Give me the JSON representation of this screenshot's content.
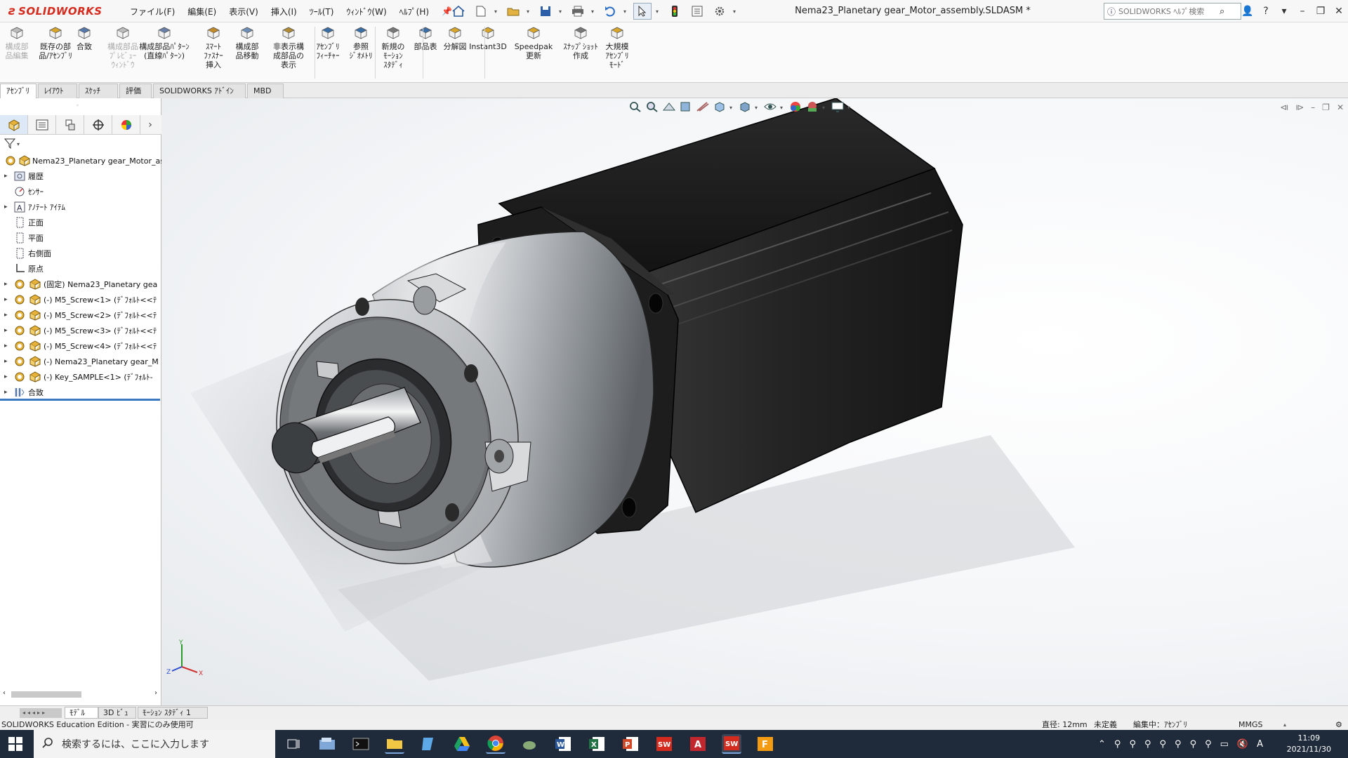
{
  "app": {
    "brand": "SOLIDWORKS",
    "title": "Nema23_Planetary gear_Motor_assembly.SLDASM *",
    "menus": [
      "ファイル(F)",
      "編集(E)",
      "表示(V)",
      "挿入(I)",
      "ﾂｰﾙ(T)",
      "ｳｨﾝﾄﾞｳ(W)",
      "ﾍﾙﾌﾟ(H)"
    ],
    "help_search_placeholder": "SOLIDWORKS ﾍﾙﾌﾟ検索"
  },
  "ribbon": {
    "items": [
      {
        "label": "構成部\n品編集",
        "enabled": false
      },
      {
        "label": "既存の部\n品/ｱｾﾝﾌﾞﾘ",
        "enabled": true
      },
      {
        "label": "合致",
        "enabled": true
      },
      {
        "label": "構成部品\nﾌﾟﾚﾋﾞｭｰ\nｳｨﾝﾄﾞｳ",
        "enabled": false
      },
      {
        "label": "構成部品ﾊﾟﾀｰﾝ\n(直線ﾊﾟﾀｰﾝ)",
        "enabled": true
      },
      {
        "label": "ｽﾏｰﾄ\nﾌｧｽﾅｰ\n挿入",
        "enabled": true
      },
      {
        "label": "構成部\n品移動",
        "enabled": true
      },
      {
        "label": "非表示構\n成部品の\n表示",
        "enabled": true
      },
      {
        "label": "ｱｾﾝﾌﾞﾘ\nﾌｨｰﾁｬｰ",
        "enabled": true
      },
      {
        "label": "参照\nｼﾞｵﾒﾄﾘ",
        "enabled": true
      },
      {
        "label": "新規の\nﾓｰｼｮﾝ\nｽﾀﾃﾞｨ",
        "enabled": true
      },
      {
        "label": "部品表",
        "enabled": true
      },
      {
        "label": "分解図",
        "enabled": true
      },
      {
        "label": "Instant3D",
        "enabled": true
      },
      {
        "label": "Speedpak\n更新",
        "enabled": true
      },
      {
        "label": "ｽﾅｯﾌﾟｼｮｯﾄ\n作成",
        "enabled": true
      },
      {
        "label": "大規模\nｱｾﾝﾌﾞﾘ\nﾓｰﾄﾞ",
        "enabled": true
      }
    ]
  },
  "cm_tabs": [
    "ｱｾﾝﾌﾞﾘ",
    "ﾚｲｱｳﾄ",
    "ｽｹｯﾁ",
    "評価",
    "SOLIDWORKS ｱﾄﾞｲﾝ",
    "MBD"
  ],
  "tree": [
    {
      "label": "Nema23_Planetary gear_Motor_as",
      "icon": "assembly-icon",
      "expand": ""
    },
    {
      "label": "履歴",
      "icon": "history-icon",
      "expand": "▸"
    },
    {
      "label": "ｾﾝｻｰ",
      "icon": "sensor-icon",
      "expand": ""
    },
    {
      "label": "ｱﾉﾃｰﾄ ｱｲﾃﾑ",
      "icon": "annotation-icon",
      "expand": "▸"
    },
    {
      "label": "正面",
      "icon": "plane-icon",
      "expand": ""
    },
    {
      "label": "平面",
      "icon": "plane-icon",
      "expand": ""
    },
    {
      "label": "右側面",
      "icon": "plane-icon",
      "expand": ""
    },
    {
      "label": "原点",
      "icon": "origin-icon",
      "expand": ""
    },
    {
      "label": "(固定) Nema23_Planetary gea",
      "icon": "part-icon",
      "expand": "▸"
    },
    {
      "label": "(-) M5_Screw<1> (ﾃﾞﾌｫﾙﾄ<<ﾃ",
      "icon": "part-icon",
      "expand": "▸"
    },
    {
      "label": "(-) M5_Screw<2> (ﾃﾞﾌｫﾙﾄ<<ﾃ",
      "icon": "part-icon",
      "expand": "▸"
    },
    {
      "label": "(-) M5_Screw<3> (ﾃﾞﾌｫﾙﾄ<<ﾃ",
      "icon": "part-icon",
      "expand": "▸"
    },
    {
      "label": "(-) M5_Screw<4> (ﾃﾞﾌｫﾙﾄ<<ﾃ",
      "icon": "part-icon",
      "expand": "▸"
    },
    {
      "label": "(-) Nema23_Planetary gear_M",
      "icon": "part-icon",
      "expand": "▸"
    },
    {
      "label": "(-) Key_SAMPLE<1> (ﾃﾞﾌｫﾙﾄ-",
      "icon": "part-icon",
      "expand": "▸"
    },
    {
      "label": "合致",
      "icon": "mates-icon",
      "expand": "▸"
    }
  ],
  "bottom_tabs": [
    "ﾓﾃﾞﾙ",
    "3D ﾋﾞｭｰ",
    "ﾓｰｼｮﾝ ｽﾀﾃﾞｨ 1"
  ],
  "status": {
    "edition": "SOLIDWORKS Education Edition - 実習にのみ使用可",
    "diameter": "直径: 12mm",
    "definition": "未定義",
    "editing": "編集中：ｱｾﾝﾌﾞﾘ",
    "units": "MMGS"
  },
  "taskbar": {
    "search_placeholder": "検索するには、ここに入力します",
    "time": "11:09",
    "date": "2021/11/30",
    "ime": "A"
  },
  "triad": {
    "x": "X",
    "y": "Y",
    "z": "Z"
  },
  "colors": {
    "brand_red": "#d52b1e",
    "motor_black": "#1f1f1f",
    "gearbox_silver": "#bfc3c6",
    "selection_blue": "#3a78c2"
  }
}
